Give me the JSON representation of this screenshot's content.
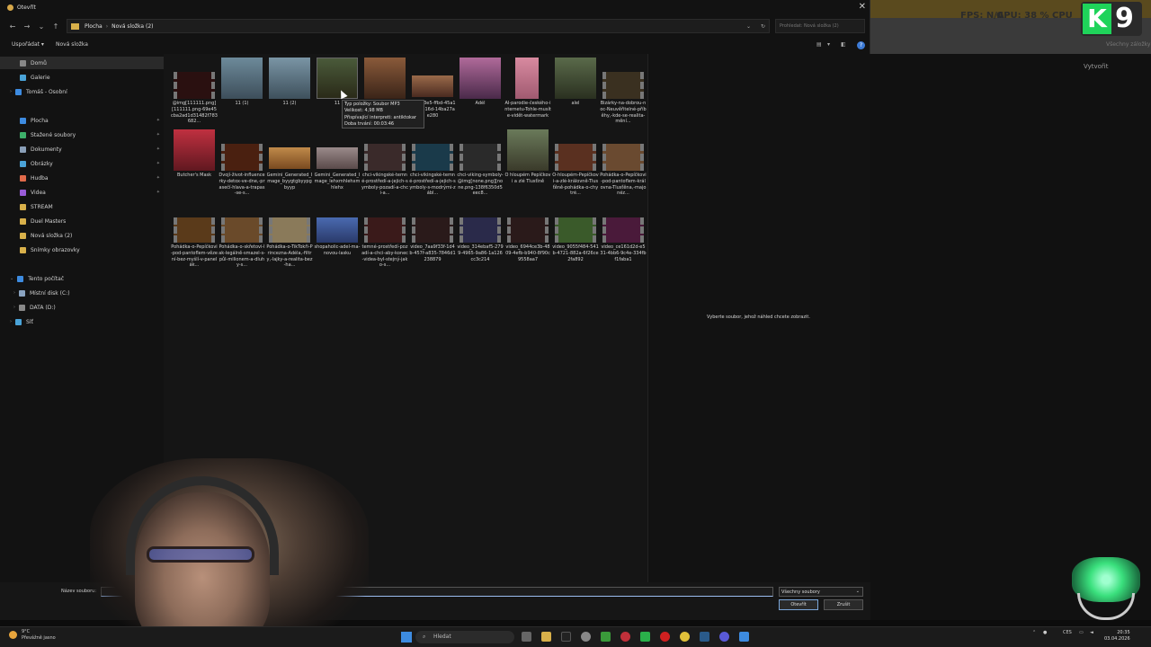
{
  "background": {
    "stats": [
      "FPS: N/A",
      "GPU: 38 %",
      "CPU"
    ],
    "create_button": "Vytvořit",
    "bookmarks_label": "Všechny záložky",
    "channel_letter": "K",
    "channel_number": "9"
  },
  "dialog": {
    "title": "Otevřít",
    "close_glyph": "✕",
    "address": [
      "Plocha",
      "Nová složka (2)"
    ],
    "address_sep": "›",
    "search_placeholder": "Prohledat: Nová složka (2)",
    "toolbar": {
      "organize": "Uspořádat ▾",
      "new_folder": "Nová složka",
      "help": "?"
    },
    "nav": {
      "home": "Domů",
      "gallery": "Galerie",
      "personal": "Tomáš - Osobní",
      "desktop": "Plocha",
      "downloads": "Stažené soubory",
      "documents": "Dokumenty",
      "pictures": "Obrázky",
      "music": "Hudba",
      "videos": "Videa",
      "stream": "STREAM",
      "duel": "Duel Masters",
      "newfolder": "Nová složka (2)",
      "screenshots": "Snímky obrazovky",
      "thispc": "Tento počítač",
      "diskc": "Místní disk (C:)",
      "diskd": "DATA (D:)",
      "network": "Síť"
    },
    "files": [
      "@img[111111.png][111111.png-69e45cba2ad1d31482f783682...",
      "11 (1)",
      "11 (2)",
      "11",
      "",
      "2e17e3e5-ffbd-45a1-b7b8-16d-14ba27ae280",
      "Adél",
      "AI-parodie-českého-internetu-Tohle-musíte-vidět-watermark",
      "alel",
      "Bizárky-na-dobrou-noc-Neuvěřitelné-příběhy,-kde-se-realita-mění...",
      "Butcher's Mask",
      "Dvojí-život-influencerky-detox-ve-dne,-prasečí-hlava-a-trapas-se-s...",
      "Gemini_Generated_Image_byygtgbyypgbyyp",
      "Gemini_Generated_Image_lehxmhlehxmhlehx",
      "chci-vikingské-temné-prostředí-a-jejich-symboly-pozadí-a-chci-a...",
      "chci-vikingské-temné-prostředí-a-jejich-symboly-s-modrými-zábl...",
      "chci-viking-symboly-@img[none.png][none.png-138f6350d5eec8...",
      "O hloupém Pepíčkovi a zlé Tlusťině",
      "O-hloupém-Pepíčkovi-a-zlé-královně-Tlusťěně-pohádka-o-chytré...",
      "Pohádka-o-Pepíčkovi-pod-pantoflem-královna-Tlusťěna,-majonéz...",
      "Pohádka-o-Pepíčkovi-pod-pantoflem-vězení-bez-myšlí-v-panelák...",
      "Pohádka-o-skřetovi-lak-legálně-smazel-s-půl-milionem-a-dluhy-s...",
      "Pohádka-o-TikTokři-Princezna-Adéla,-filtry,-lajky-a-realita-bez-ha...",
      "shopaholic-adel-ma-novou-lasku",
      "temné-prostředí-pozadí-a-chci-aby-konec-videa-byl-stejný-jako-s...",
      "video_7aa9f33f-1d4b-457f-a835-7846d1238879",
      "video_314ebaf5-2799-4965-9a86-1a126cc3c214",
      "video_6944ce3b-4809-4efb-b940-8f90c9558aa7",
      "video_9055f484-541b-4721-882a-6f26ce2fa892",
      "video_ce161d2d-e531-4bb6-9c4e-334fbf1faba1"
    ],
    "tooltip": [
      "Typ položky: Soubor MP3",
      "Velikost: 4,98 MB",
      "Přispívající interpreti: antiktokar",
      "Doba trvání: 00:03:46"
    ],
    "preview_message": "Vyberte soubor, jehož náhled chcete zobrazit.",
    "filename_label": "Název souboru:",
    "filename_value": "",
    "filter_value": "Všechny soubory",
    "open_button": "Otevřít",
    "cancel_button": "Zrušit"
  },
  "taskbar": {
    "weather_temp": "9°C",
    "weather_text": "Převážně jasno",
    "search": "Hledat",
    "lang": "CES",
    "time": "20:35",
    "date": "03.04.2026"
  },
  "colors": {
    "accent": "#3d8be0",
    "folder": "#d8b04a",
    "channel_green": "#1fd35a"
  }
}
